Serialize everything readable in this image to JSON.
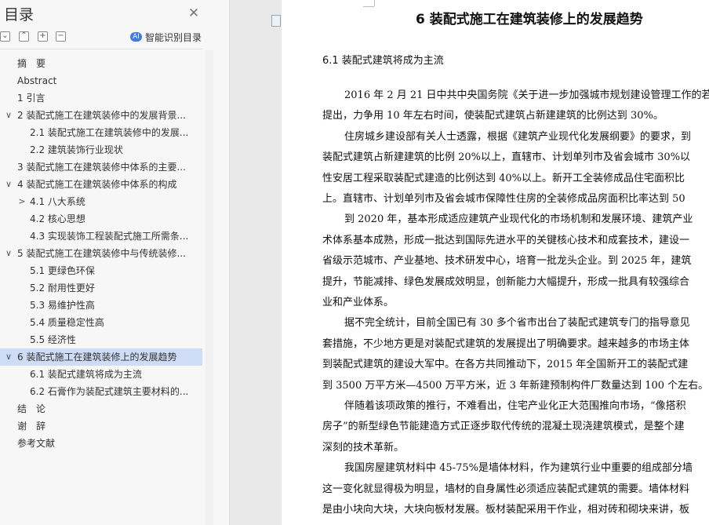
{
  "toc": {
    "title": "目录",
    "close_glyph": "✕",
    "toolbar": {
      "collapse_glyph": "⌄",
      "up_glyph": "⌃",
      "add_glyph": "+",
      "remove_glyph": "−",
      "smart_label": "智能识别目录",
      "smart_icon": "ai-recognize-icon"
    },
    "items": [
      {
        "label": "摘　要",
        "level": 1,
        "caret": "",
        "active": false
      },
      {
        "label": "Abstract",
        "level": 1,
        "caret": "",
        "active": false
      },
      {
        "label": "1 引言",
        "level": 1,
        "caret": "",
        "active": false
      },
      {
        "label": "2 装配式施工在建筑装修中的发展背景...",
        "level": 1,
        "caret": "∨",
        "active": false
      },
      {
        "label": "2.1 装配式施工在建筑装修中的发展...",
        "level": 2,
        "caret": "",
        "active": false
      },
      {
        "label": "2.2 建筑装饰行业现状",
        "level": 2,
        "caret": "",
        "active": false
      },
      {
        "label": "3 装配式施工在建筑装修中体系的主要...",
        "level": 1,
        "caret": "",
        "active": false
      },
      {
        "label": "4 装配式施工在建筑装修中体系的构成",
        "level": 1,
        "caret": "∨",
        "active": false
      },
      {
        "label": "4.1 八大系统",
        "level": 2,
        "caret": ">",
        "active": false
      },
      {
        "label": "4.2 核心思想",
        "level": 2,
        "caret": "",
        "active": false
      },
      {
        "label": "4.3 实现装饰工程装配式施工所需条...",
        "level": 2,
        "caret": "",
        "active": false
      },
      {
        "label": "5 装配式施工在建筑装修中与传统装修...",
        "level": 1,
        "caret": "∨",
        "active": false
      },
      {
        "label": "5.1 更绿色环保",
        "level": 2,
        "caret": "",
        "active": false
      },
      {
        "label": "5.2 耐用性更好",
        "level": 2,
        "caret": "",
        "active": false
      },
      {
        "label": "5.3 易维护性高",
        "level": 2,
        "caret": "",
        "active": false
      },
      {
        "label": "5.4 质量稳定性高",
        "level": 2,
        "caret": "",
        "active": false
      },
      {
        "label": "5.5 经济性",
        "level": 2,
        "caret": "",
        "active": false
      },
      {
        "label": "6 装配式施工在建筑装修上的发展趋势",
        "level": 1,
        "caret": "∨",
        "active": true
      },
      {
        "label": "6.1 装配式建筑将成为主流",
        "level": 2,
        "caret": "",
        "active": false
      },
      {
        "label": "6.2 石膏作为装配式建筑主要材料的...",
        "level": 2,
        "caret": "",
        "active": false
      },
      {
        "label": "结　论",
        "level": 1,
        "caret": "",
        "active": false
      },
      {
        "label": "谢　辞",
        "level": 1,
        "caret": "",
        "active": false
      },
      {
        "label": "参考文献",
        "level": 1,
        "caret": "",
        "active": false
      }
    ]
  },
  "document": {
    "page_icon": "document-icon",
    "heading": "6 装配式施工在建筑装修上的发展趋势",
    "subheading": "6.1 装配式建筑将成为主流",
    "lines": [
      {
        "text": "2016 年 2 月 21 日中共中央国务院《关于进一步加强城市规划建设管理工作的若",
        "indent": true
      },
      {
        "text": "提出，力争用 10 年左右时间，使装配式建筑占新建建筑的比例达到 30%。",
        "indent": false
      },
      {
        "text": "住房城乡建设部有关人士透露，根据《建筑产业现代化发展纲要》的要求，到",
        "indent": true
      },
      {
        "text": "装配式建筑占新建建筑的比例 20%以上，直辖市、计划单列市及省会城市 30%以",
        "indent": false
      },
      {
        "text": "性安居工程采取装配式建造的比例达到 40%以上。新开工全装修成品住宅面积比",
        "indent": false
      },
      {
        "text": "上。直辖市、计划单列市及省会城市保障性住房的全装修成品房面积比率达到 50",
        "indent": false
      },
      {
        "text": "到 2020 年，基本形成适应建筑产业现代化的市场机制和发展环境、建筑产业",
        "indent": true
      },
      {
        "text": "术体系基本成熟，形成一批达到国际先进水平的关键核心技术和成套技术，建设一",
        "indent": false
      },
      {
        "text": "省级示范城市、产业基地、技术研发中心，培育一批龙头企业。到 2025 年，建筑",
        "indent": false
      },
      {
        "text": "提升，节能减排、绿色发展成效明显，创新能力大幅提升，形成一批具有较强综合",
        "indent": false
      },
      {
        "text": "业和产业体系。",
        "indent": false
      },
      {
        "text": "据不完全统计，目前全国已有 30 多个省市出台了装配式建筑专门的指导意见",
        "indent": true
      },
      {
        "text": "套措施，不少地方更是对装配式建筑的发展提出了明确要求。越来越多的市场主体",
        "indent": false
      },
      {
        "text": "到装配式建筑的建设大军中。在各方共同推动下，2015 年全国新开工的装配式建",
        "indent": false
      },
      {
        "text": "到 3500 万平方米—4500 万平方米，近 3 年新建预制构件厂数量达到 100 个左右。",
        "indent": false
      },
      {
        "text": "伴随着该项政策的推行，不难看出，住宅产业化正大范围推向市场，“像搭积",
        "indent": true
      },
      {
        "text": "房子”的新型绿色节能建造方式正逐步取代传统的混凝土现浇建筑模式，是整个建",
        "indent": false
      },
      {
        "text": "深刻的技术革新。",
        "indent": false
      },
      {
        "text": "我国房屋建筑材料中 45-75%是墙体材料，作为建筑行业中重要的组成部分墙",
        "indent": true
      },
      {
        "text": "这一变化就显得极为明显，墙材的自身属性必须适应装配式建筑的需要。墙体材料",
        "indent": false
      },
      {
        "text": "是由小块向大块，大块向板材发展。板材装配采用干作业，相对砖和砌块来讲，板",
        "indent": false
      }
    ]
  }
}
